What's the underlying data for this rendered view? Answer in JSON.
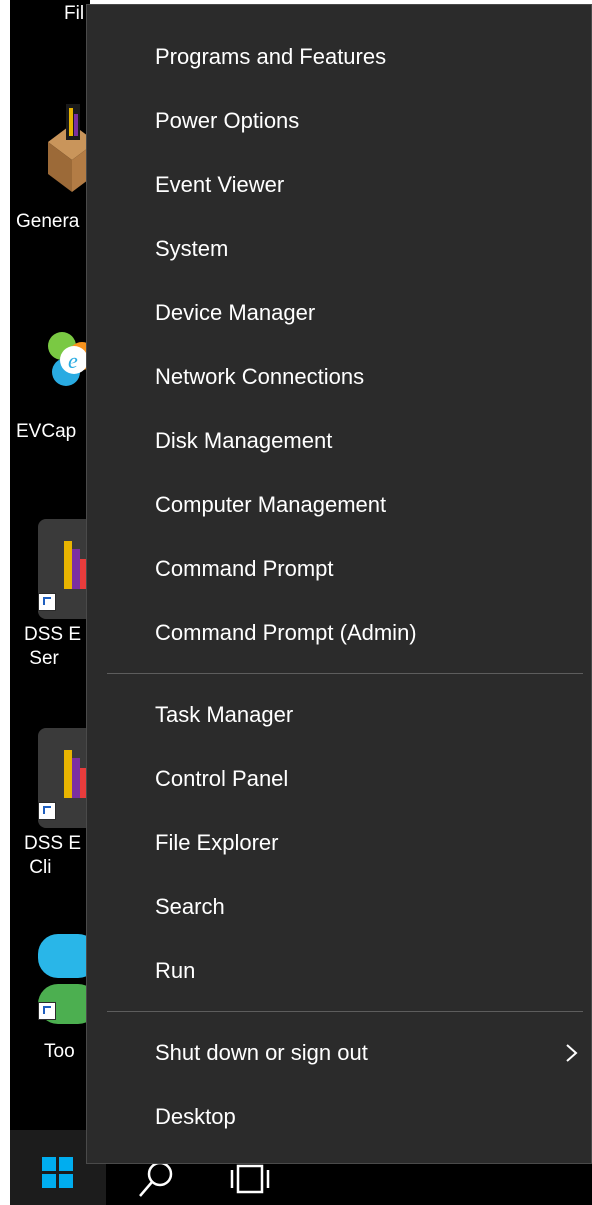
{
  "desktop": {
    "icons": [
      {
        "label": "Fil"
      },
      {
        "label": "Genera"
      },
      {
        "label": "EVCap"
      },
      {
        "label": "DSS E\n Ser"
      },
      {
        "label": "DSS E\n Cli"
      },
      {
        "label": "Too"
      }
    ]
  },
  "menu": {
    "section1": [
      "Programs and Features",
      "Power Options",
      "Event Viewer",
      "System",
      "Device Manager",
      "Network Connections",
      "Disk Management",
      "Computer Management",
      "Command Prompt",
      "Command Prompt (Admin)"
    ],
    "section2": [
      "Task Manager",
      "Control Panel",
      "File Explorer",
      "Search",
      "Run"
    ],
    "section3": [
      "Shut down or sign out",
      "Desktop"
    ]
  },
  "colors": {
    "menu_bg": "#2b2b2b",
    "menu_text": "#ffffff",
    "separator": "#5d5d5d",
    "windows_blue": "#00adef"
  },
  "icons": {
    "start": "windows-logo-icon",
    "search": "search-icon",
    "task_view": "task-view-icon",
    "submenu": "chevron-right-icon"
  }
}
